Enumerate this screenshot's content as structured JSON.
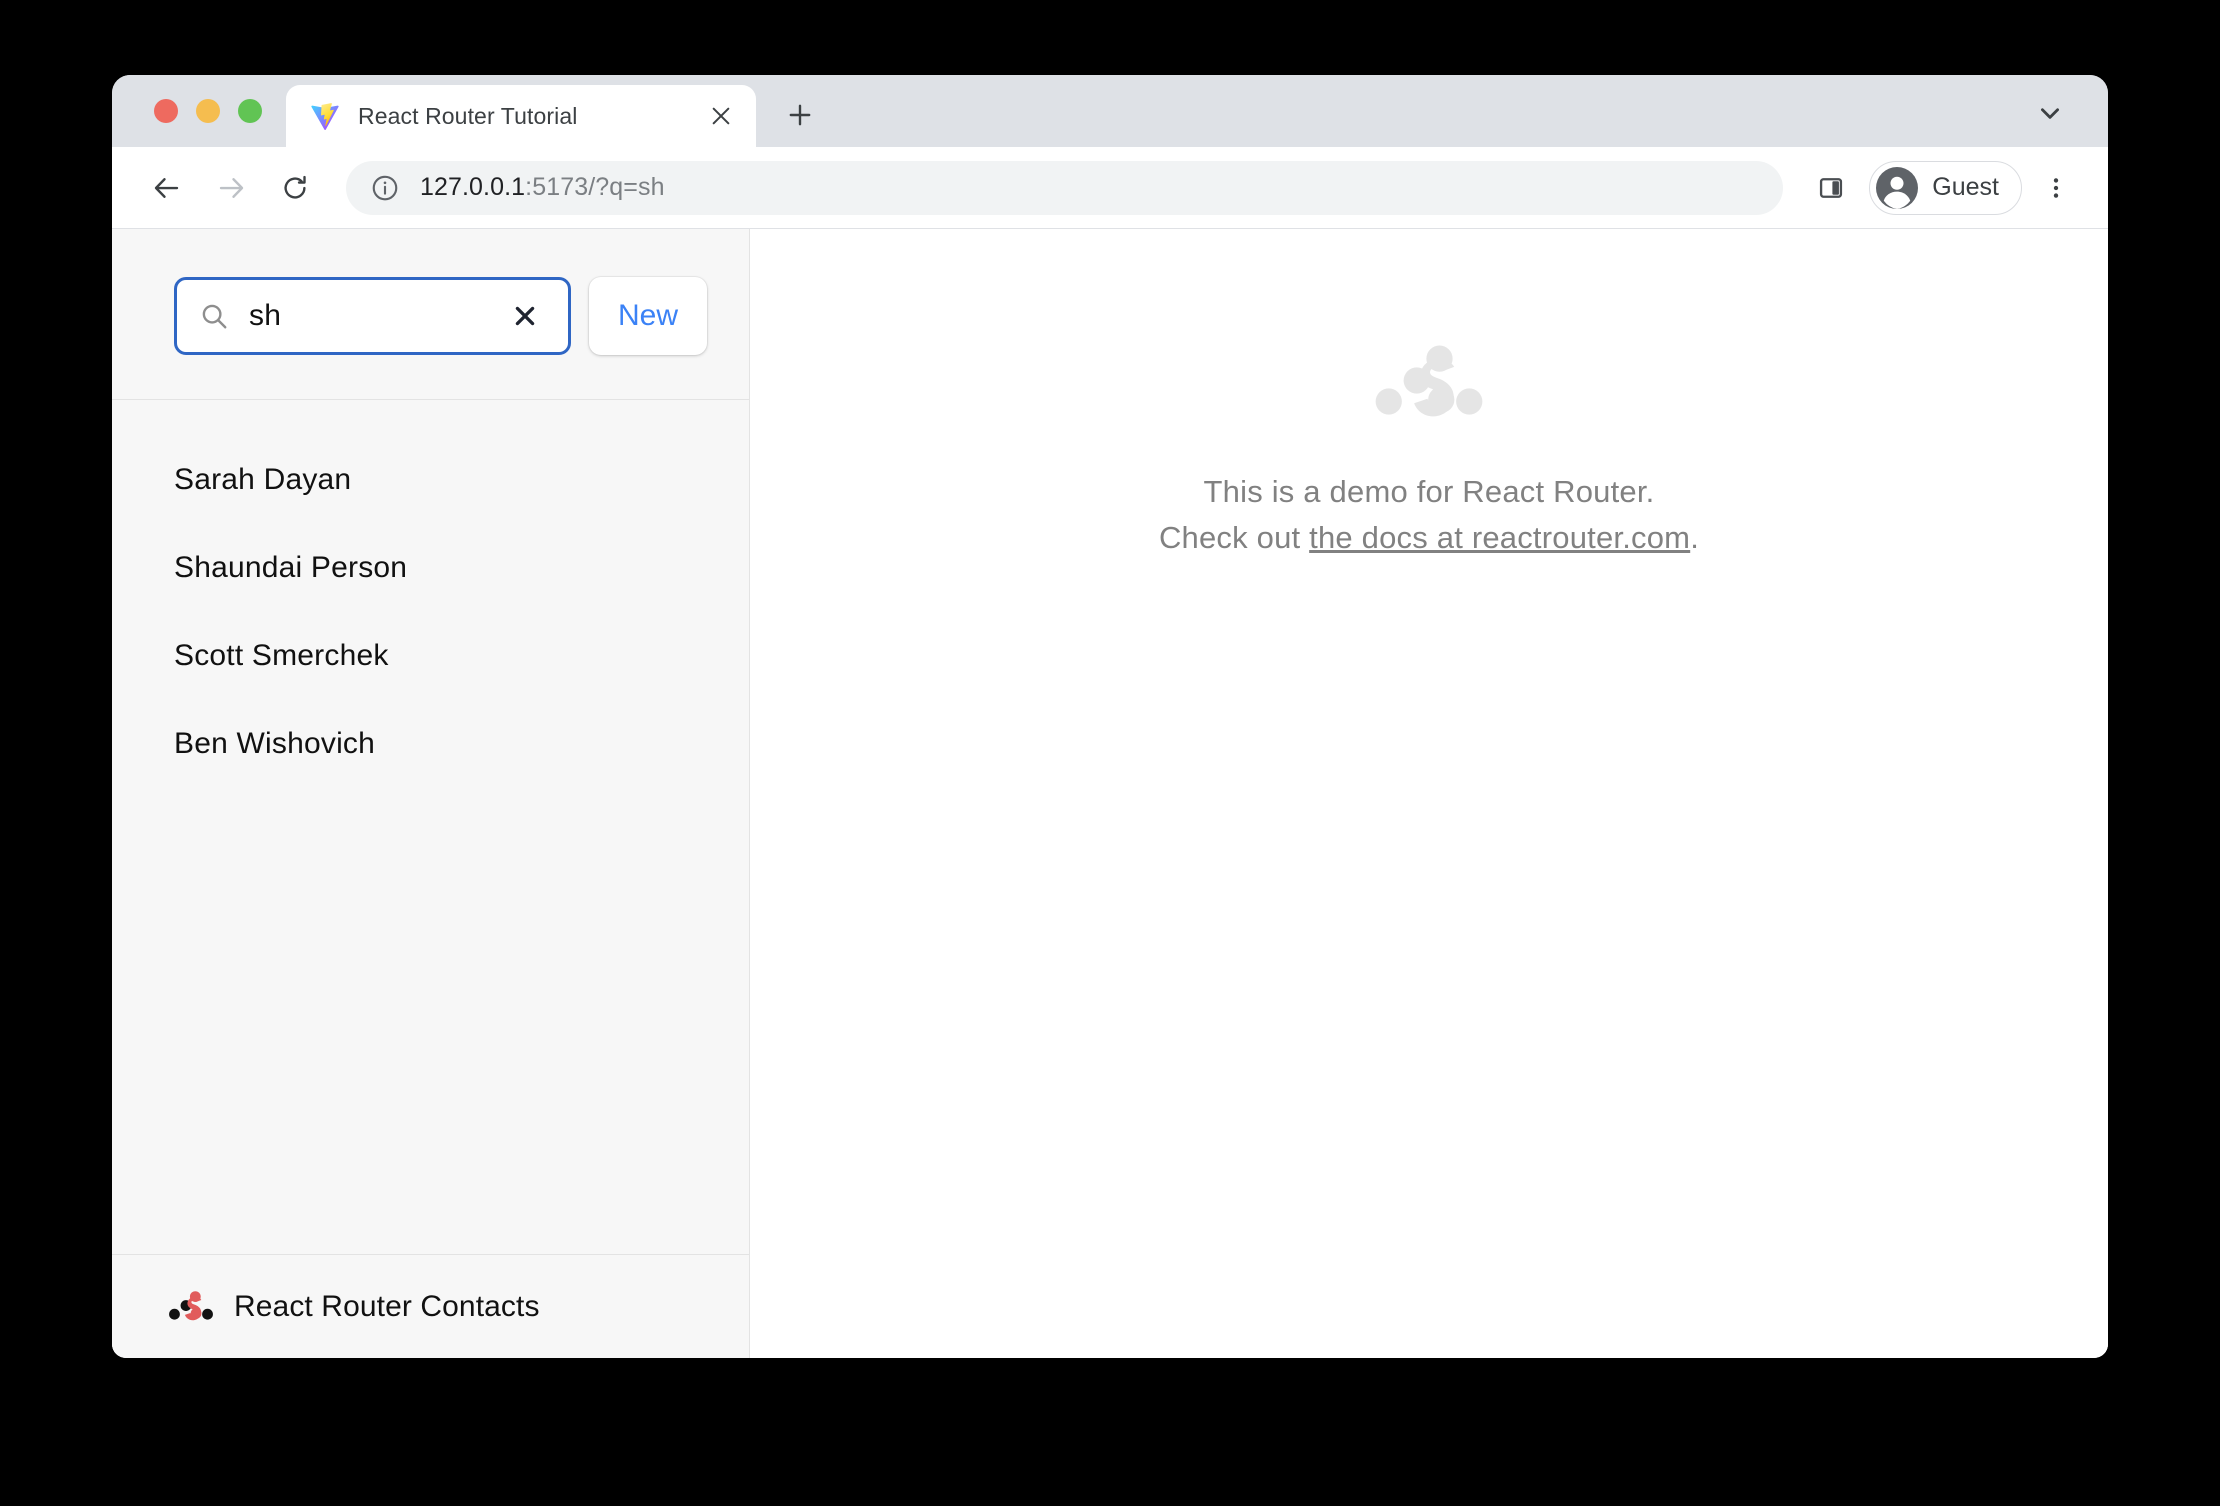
{
  "browser": {
    "traffic_lights": [
      "close",
      "minimize",
      "maximize"
    ],
    "tab": {
      "title": "React Router Tutorial",
      "favicon": "vite-logo-icon",
      "close_icon": "close-icon"
    },
    "new_tab_icon": "plus-icon",
    "tab_list_icon": "chevron-down-icon",
    "nav": {
      "back_icon": "arrow-left-icon",
      "forward_icon": "arrow-right-icon",
      "reload_icon": "reload-icon"
    },
    "omnibox": {
      "info_icon": "info-circle-icon",
      "url_host": "127.0.0.1",
      "url_rest": ":5173/?q=sh",
      "full_url": "127.0.0.1:5173/?q=sh"
    },
    "side_panel_icon": "side-panel-icon",
    "profile": {
      "label": "Guest",
      "avatar_icon": "account-circle-icon"
    },
    "menu_icon": "kebab-menu-icon"
  },
  "sidebar": {
    "search": {
      "icon": "search-icon",
      "value": "sh",
      "placeholder": "Search",
      "clear_icon": "close-icon",
      "focused": true,
      "focus_color": "#2f66c4"
    },
    "new_button": {
      "label": "New",
      "color": "#3b82f6"
    },
    "contacts": [
      {
        "name": "Sarah Dayan"
      },
      {
        "name": "Shaundai Person"
      },
      {
        "name": "Scott Smerchek"
      },
      {
        "name": "Ben Wishovich"
      }
    ],
    "footer": {
      "logo_icon": "react-router-logo-icon",
      "title": "React Router Contacts",
      "logo_accent_color": "#e15b5b"
    }
  },
  "main": {
    "logo_icon": "react-router-logo-icon",
    "logo_color": "#e5e5e5",
    "line1": "This is a demo for React Router.",
    "line2_prefix": "Check out ",
    "line2_link": "the docs at reactrouter.com",
    "line2_suffix": ".",
    "text_color": "#818181"
  }
}
